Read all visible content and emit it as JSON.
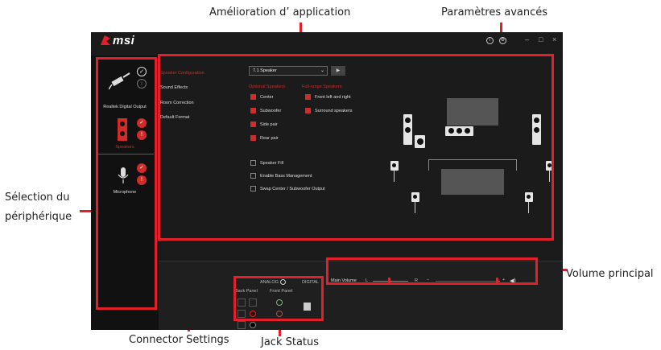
{
  "callouts": {
    "app_enhance": "Amélioration d’ application",
    "advanced": "Paramètres avancés",
    "device_select_1": "Sélection du",
    "device_select_2": "périphérique",
    "main_volume": "Volume principal",
    "connector": "Connector Settings",
    "jack_status": "Jack Status"
  },
  "app": {
    "logo": "msi",
    "info_icon": "info-icon",
    "gear_icon": "gear-icon",
    "window_controls": [
      "–",
      "□",
      "×"
    ]
  },
  "devices": [
    {
      "label": "Realtek Digital Output",
      "icon": "plug-icon",
      "selected": false
    },
    {
      "label": "Speakers",
      "icon": "speaker-icon",
      "selected": true
    },
    {
      "label": "Microphone",
      "icon": "microphone-icon",
      "selected": false
    }
  ],
  "menu": [
    "Speaker Configuration",
    "Sound Effects",
    "Room Correction",
    "Default Format"
  ],
  "config": {
    "dropdown": "7.1 Speaker",
    "optional_title": "Optional Speakers",
    "fullrange_title": "Full-range Speakers",
    "optional": [
      "Center",
      "Subwoofer",
      "Side pair",
      "Rear pair"
    ],
    "fullrange": [
      "Front left and right",
      "Surround speakers"
    ],
    "extras": [
      "Speaker Fill",
      "Enable Bass Management",
      "Swap Center / Subwoofer Output"
    ]
  },
  "bottom": {
    "analog": "ANALOG",
    "digital": "DIGITAL",
    "back_panel": "Back Panel",
    "front_panel": "Front Panel",
    "main_volume": "Main Volume",
    "left": "L",
    "right": "R",
    "minus": "–",
    "plus": "+",
    "balance": 0.45,
    "volume": 0.95
  },
  "colors": {
    "accent": "#e3202a",
    "bg": "#1b1b1b"
  }
}
